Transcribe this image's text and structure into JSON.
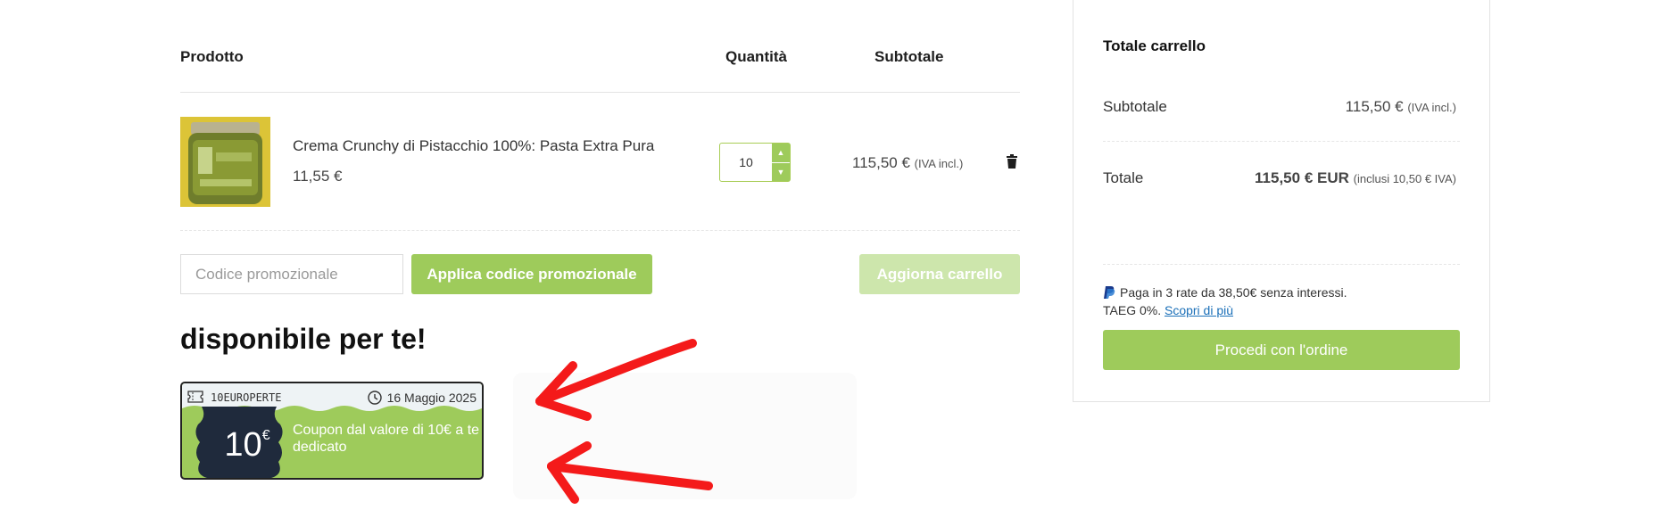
{
  "cart": {
    "headers": {
      "product": "Prodotto",
      "quantity": "Quantità",
      "subtotal": "Subtotale"
    },
    "item": {
      "name": "Crema Crunchy di Pistacchio 100%: Pasta Extra Pura",
      "price": "11,55 €",
      "quantity": "10",
      "line_subtotal": "115,50 €",
      "line_subtotal_note": "(IVA incl.)"
    },
    "promo_placeholder": "Codice promozionale",
    "apply_button": "Applica codice promozionale",
    "update_button": "Aggiorna carrello"
  },
  "coupons": {
    "heading": "disponibile per te!",
    "card": {
      "code": "10EUROPERTE",
      "expiry": "16 Maggio 2025",
      "amount": "10",
      "currency": "€",
      "description": "Coupon dal valore di 10€ a te dedicato"
    }
  },
  "totals": {
    "title": "Totale carrello",
    "subtotal_label": "Subtotale",
    "subtotal_value": "115,50 €",
    "subtotal_note": "(IVA incl.)",
    "total_label": "Totale",
    "total_value": "115,50 € EUR",
    "total_note": "(inclusi 10,50 € IVA)",
    "paypal_text": "Paga in 3 rate da 38,50€ senza interessi.",
    "taeg_text": "TAEG 0%.",
    "learn_more": "Scopri di più",
    "checkout_button": "Procedi con l'ordine"
  },
  "colors": {
    "accent_green": "#9ecb5b",
    "arrow_red": "#f41a1a",
    "link_blue": "#1a6fb8"
  },
  "icons": [
    "trash-icon",
    "ticket-icon",
    "clock-icon",
    "paypal-icon",
    "chevron-up-icon",
    "chevron-down-icon",
    "arrow-icon"
  ]
}
